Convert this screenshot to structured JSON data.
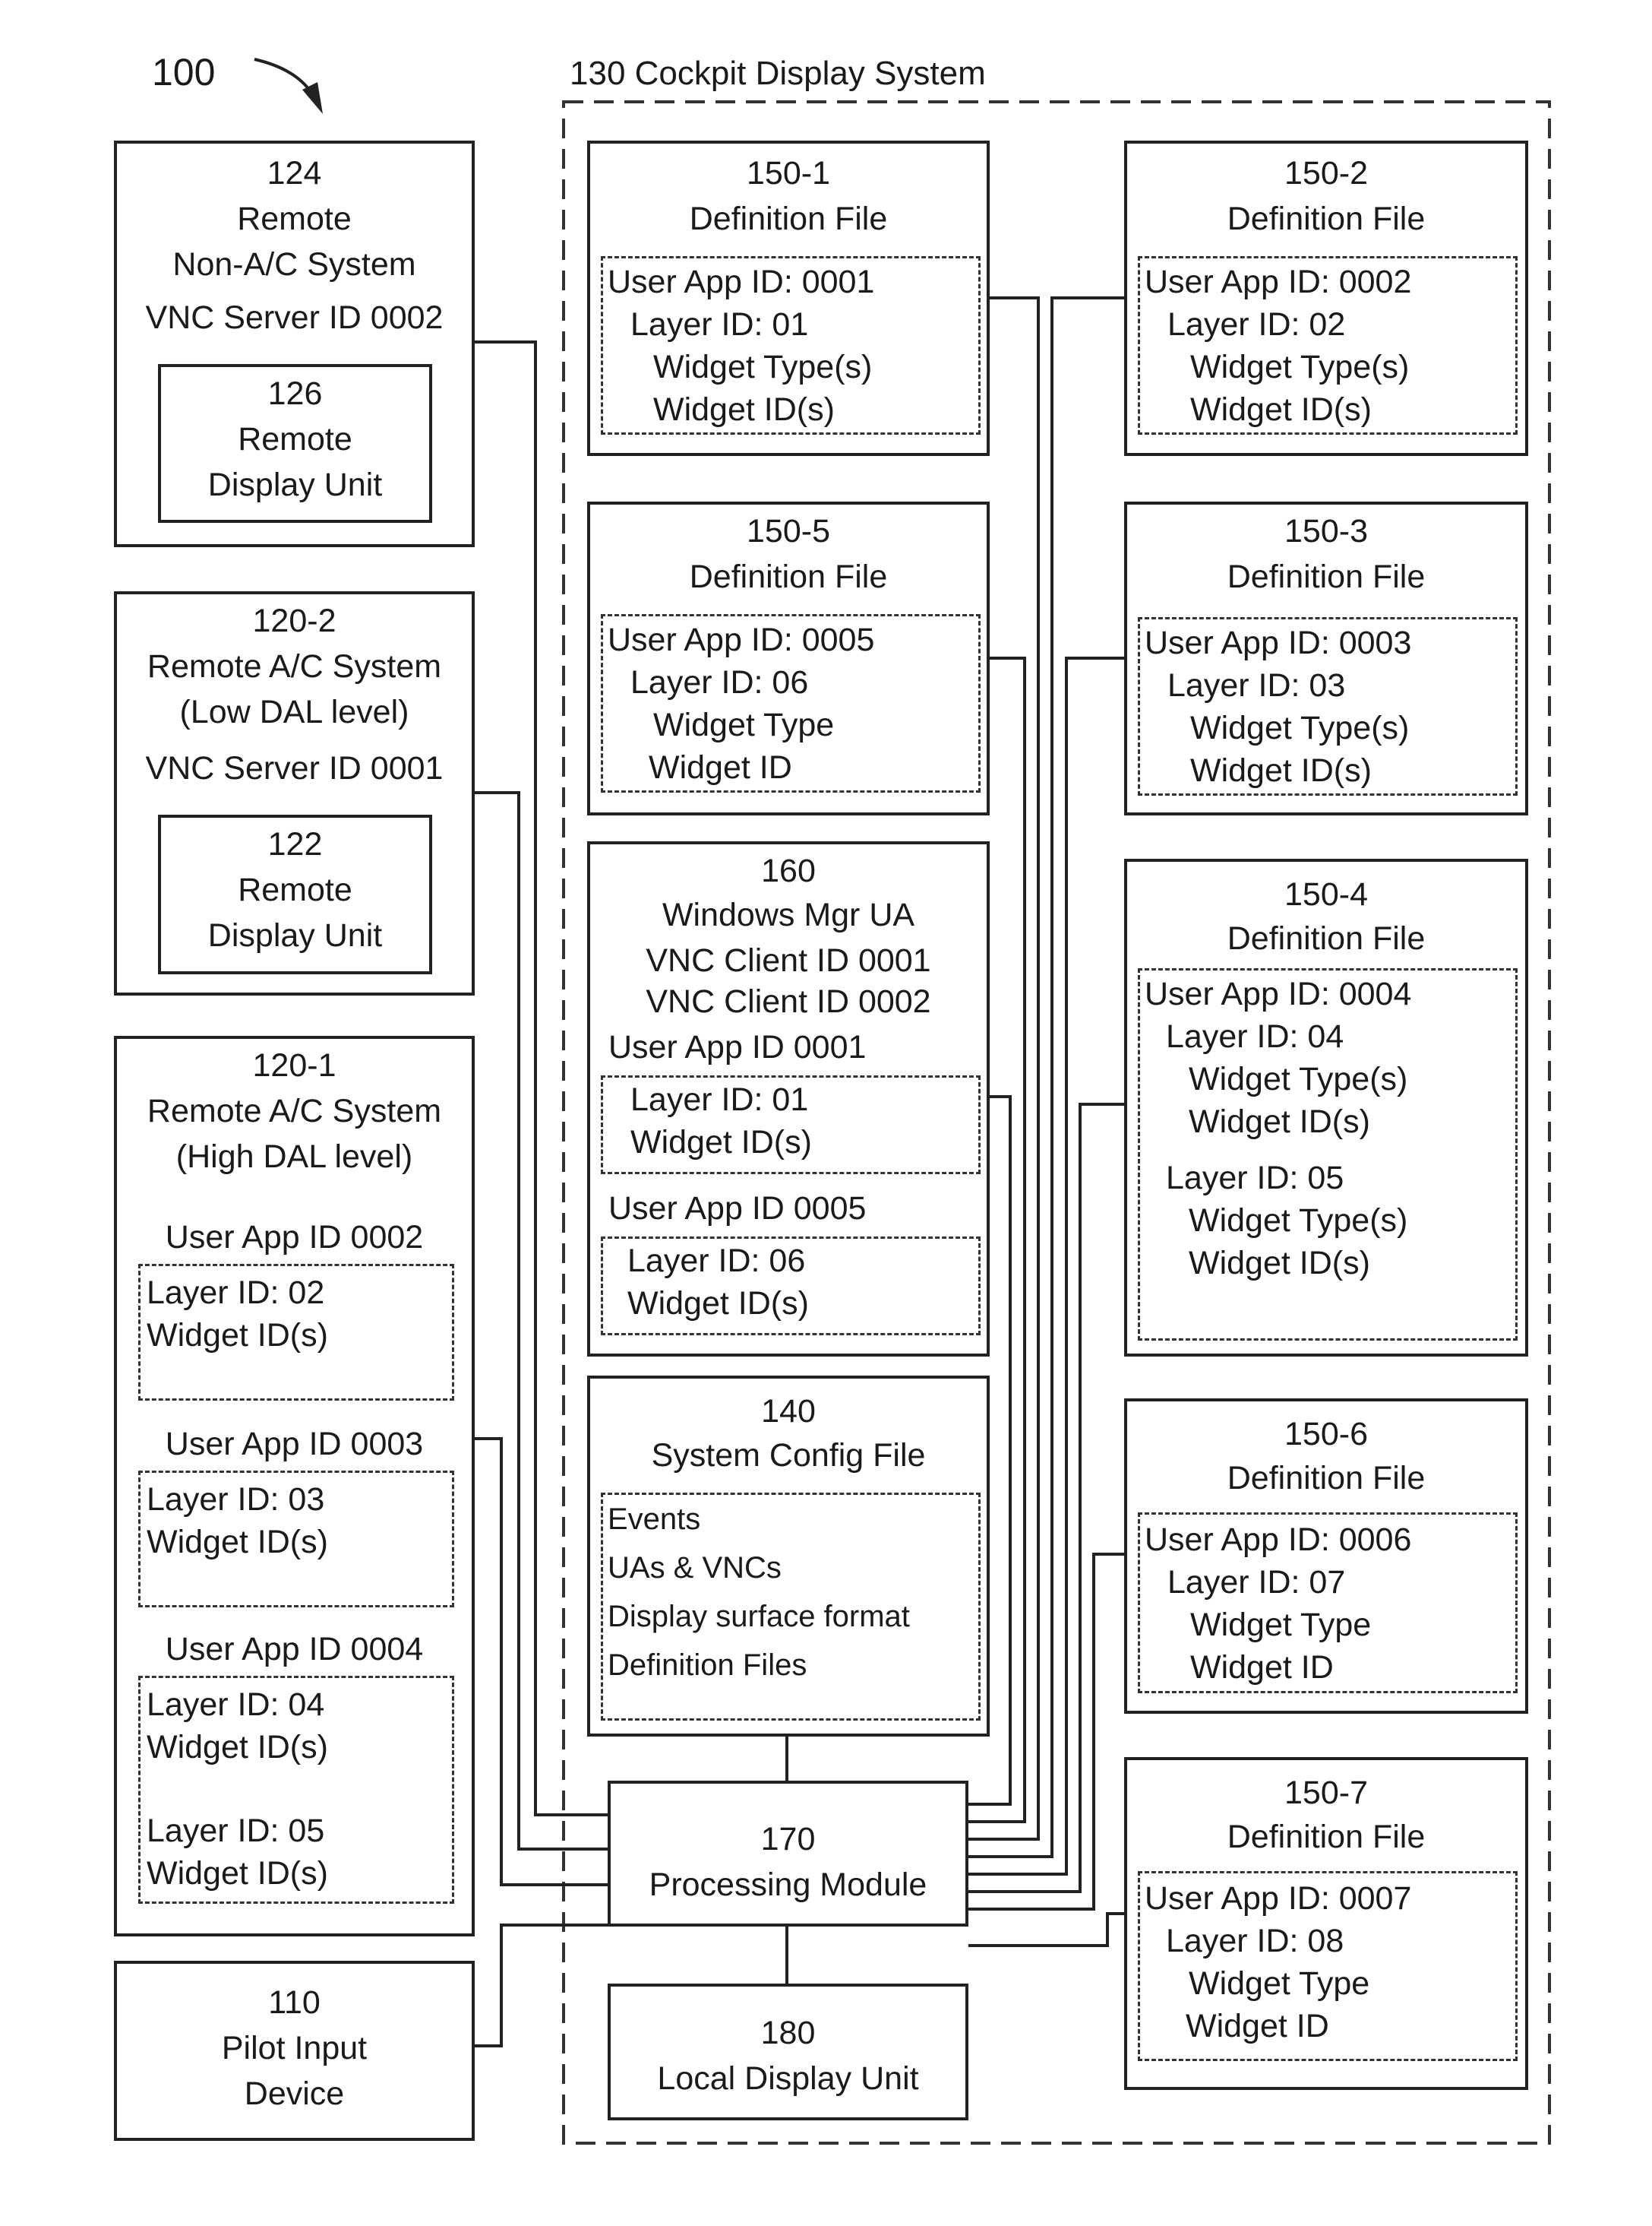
{
  "figure_label": "100",
  "cockpit": {
    "label": "130 Cockpit Display System"
  },
  "left": {
    "non_ac": {
      "num": "124",
      "line1": "Remote",
      "line2": "Non-A/C System",
      "server": "VNC Server ID 0002",
      "display": {
        "num": "126",
        "line1": "Remote",
        "line2": "Display Unit"
      }
    },
    "low_dal": {
      "num": "120-2",
      "line1": "Remote A/C System",
      "line2": "(Low DAL level)",
      "server": "VNC Server ID 0001",
      "display": {
        "num": "122",
        "line1": "Remote",
        "line2": "Display Unit"
      }
    },
    "high_dal": {
      "num": "120-1",
      "line1": "Remote A/C System",
      "line2": "(High DAL level)",
      "apps": [
        {
          "title": "User App ID 0002",
          "lines": [
            "Layer ID: 02",
            "Widget ID(s)"
          ]
        },
        {
          "title": "User App ID 0003",
          "lines": [
            "Layer ID: 03",
            "Widget ID(s)"
          ]
        },
        {
          "title": "User App ID 0004",
          "lines": [
            "Layer ID: 04",
            "Widget ID(s)",
            "",
            "Layer ID: 05",
            "Widget ID(s)"
          ]
        }
      ]
    },
    "pilot": {
      "num": "110",
      "line1": "Pilot Input",
      "line2": "Device"
    }
  },
  "center": {
    "def1": {
      "num": "150-1",
      "title": "Definition File",
      "lines": [
        "User App ID: 0001",
        "Layer ID: 01",
        "Widget Type(s)",
        "Widget ID(s)"
      ]
    },
    "def5": {
      "num": "150-5",
      "title": "Definition File",
      "lines": [
        "User App ID: 0005",
        "Layer ID: 06",
        "Widget Type",
        "Widget ID"
      ]
    },
    "wm": {
      "num": "160",
      "title": "Windows Mgr UA",
      "client1": "VNC Client ID 0001",
      "client2": "VNC Client ID 0002",
      "app1": {
        "title": "User App ID 0001",
        "lines": [
          "Layer ID: 01",
          "Widget ID(s)"
        ]
      },
      "app2": {
        "title": "User App ID 0005",
        "lines": [
          "Layer ID: 06",
          "Widget ID(s)"
        ]
      }
    },
    "config": {
      "num": "140",
      "title": "System Config File",
      "lines": [
        "Events",
        "UAs & VNCs",
        "Display surface format",
        "Definition Files"
      ]
    },
    "proc": {
      "num": "170",
      "title": "Processing Module"
    },
    "local": {
      "num": "180",
      "title": "Local Display Unit"
    }
  },
  "right": {
    "def2": {
      "num": "150-2",
      "title": "Definition File",
      "lines": [
        "User App ID: 0002",
        "Layer ID: 02",
        "Widget Type(s)",
        "Widget ID(s)"
      ]
    },
    "def3": {
      "num": "150-3",
      "title": "Definition File",
      "lines": [
        "User App ID: 0003",
        "Layer ID: 03",
        "Widget Type(s)",
        "Widget ID(s)"
      ]
    },
    "def4": {
      "num": "150-4",
      "title": "Definition File",
      "lines": [
        "User App ID: 0004",
        "Layer ID: 04",
        "Widget Type(s)",
        "Widget ID(s)",
        "Layer ID: 05",
        "Widget Type(s)",
        "Widget ID(s)"
      ]
    },
    "def6": {
      "num": "150-6",
      "title": "Definition File",
      "lines": [
        "User App ID: 0006",
        "Layer ID: 07",
        "Widget Type",
        "Widget ID"
      ]
    },
    "def7": {
      "num": "150-7",
      "title": "Definition File",
      "lines": [
        "User App ID: 0007",
        "Layer ID: 08",
        "Widget Type",
        "Widget ID"
      ]
    }
  }
}
